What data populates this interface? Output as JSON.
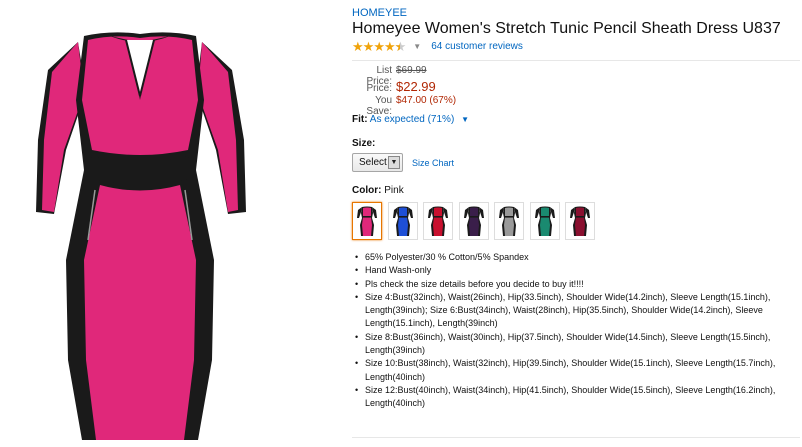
{
  "product": {
    "brand": "HOMEYEE",
    "title": "Homeyee Women's Stretch Tunic Pencil Sheath Dress U837",
    "rating": 4.5,
    "review_count_text": "64 customer reviews"
  },
  "pricing": {
    "list_price_label": "List Price:",
    "list_price": "$69.99",
    "price_label": "Price:",
    "price": "$22.99",
    "save_label": "You Save:",
    "save": "$47.00 (67%)"
  },
  "fit": {
    "label": "Fit:",
    "value": "As expected (71%)"
  },
  "size": {
    "label": "Size:",
    "selected": "Select",
    "chart_link": "Size Chart"
  },
  "color": {
    "label": "Color:",
    "selected": "Pink",
    "swatches": [
      {
        "name": "Pink",
        "main": "#e0287a",
        "side": "#1a1a1a"
      },
      {
        "name": "Blue",
        "main": "#1e4fd6",
        "side": "#1a1a1a"
      },
      {
        "name": "Red",
        "main": "#c8102e",
        "side": "#1a1a1a"
      },
      {
        "name": "Purple",
        "main": "#3a1e4a",
        "side": "#1a1a1a"
      },
      {
        "name": "Gray",
        "main": "#9a9a9a",
        "side": "#1a1a1a"
      },
      {
        "name": "Green",
        "main": "#1a8a70",
        "side": "#1a1a1a"
      },
      {
        "name": "Wine",
        "main": "#8a1030",
        "side": "#1a1a1a"
      }
    ]
  },
  "features": [
    "65% Polyester/30 % Cotton/5% Spandex",
    "Hand Wash-only",
    "Pls check the size details before you decide to buy it!!!!",
    "Size 4:Bust(32inch), Waist(26inch), Hip(33.5inch), Shoulder Wide(14.2inch), Sleeve Length(15.1inch), Length(39inch); Size 6:Bust(34inch), Waist(28inch), Hip(35.5inch), Shoulder Wide(14.2inch), Sleeve Length(15.1inch), Length(39inch)",
    "Size 8:Bust(36inch), Waist(30inch), Hip(37.5inch), Shoulder Wide(14.5inch), Sleeve Length(15.5inch), Length(39inch)",
    "Size 10:Bust(38inch), Waist(32inch), Hip(39.5inch), Shoulder Wide(15.1inch), Sleeve Length(15.7inch), Length(40inch)",
    "Size 12:Bust(40inch), Waist(34inch), Hip(41.5inch), Shoulder Wide(15.5inch), Sleeve Length(16.2inch), Length(40inch)"
  ],
  "colors": {
    "link": "#0066c0",
    "price": "#b12704",
    "star": "#f0a30a",
    "dress_main": "#e0287a",
    "dress_side": "#1a1a1a"
  }
}
